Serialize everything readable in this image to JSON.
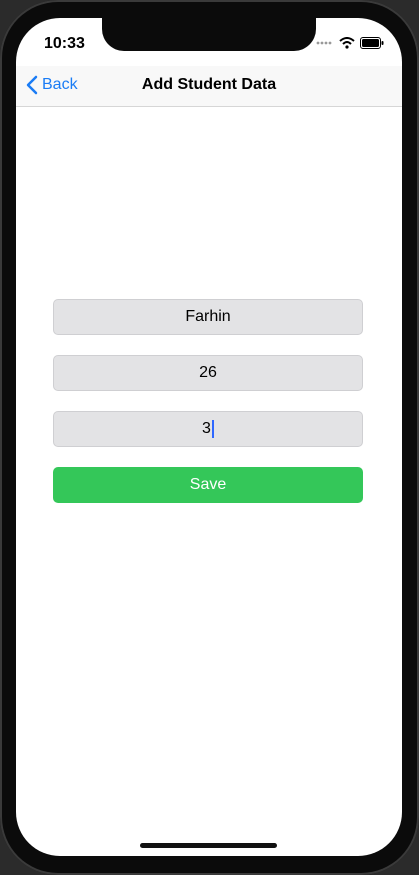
{
  "status_bar": {
    "time": "10:33"
  },
  "nav": {
    "back_label": "Back",
    "title": "Add Student Data"
  },
  "form": {
    "name_value": "Farhin",
    "age_value": "26",
    "grade_value": "3",
    "save_label": "Save"
  },
  "colors": {
    "accent_blue": "#1a7cf5",
    "save_green": "#34c759",
    "field_bg": "#e3e3e5"
  }
}
